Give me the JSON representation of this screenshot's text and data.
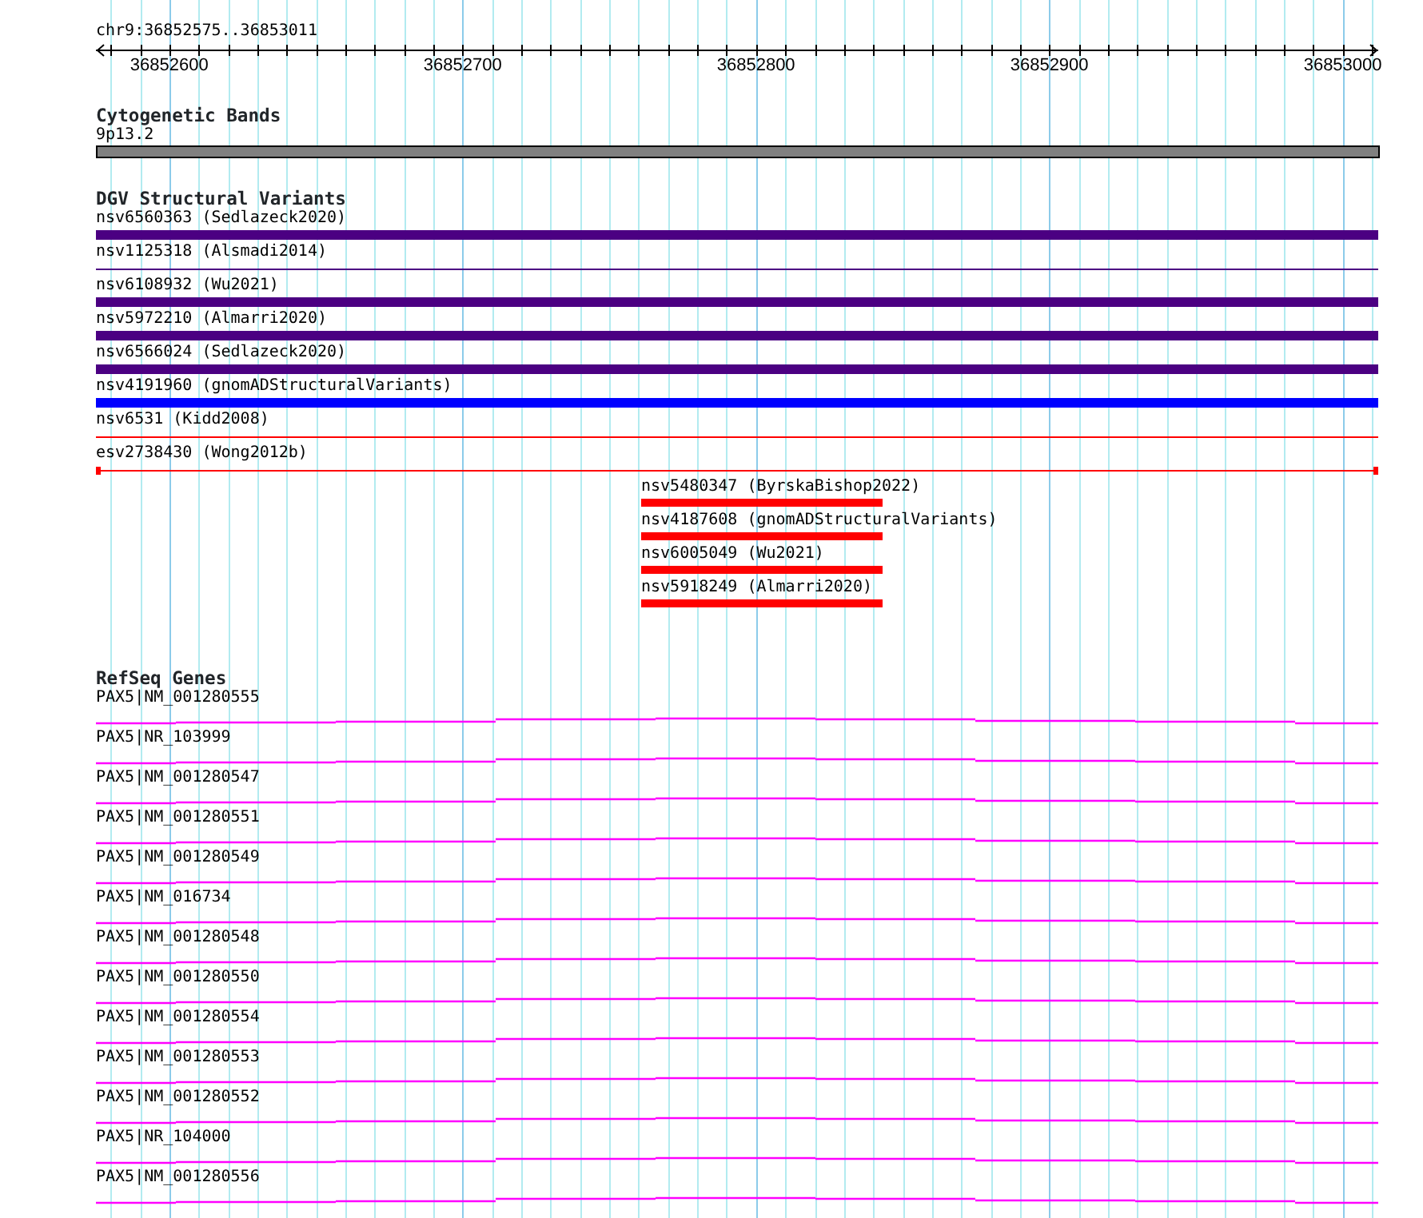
{
  "ruler": {
    "location": "chr9:36852575..36853011",
    "tick_labels": [
      "36852600",
      "36852700",
      "36852800",
      "36852900",
      "36853000"
    ]
  },
  "cytogenetic_bands": {
    "title": "Cytogenetic Bands",
    "bands": [
      {
        "label": "9p13.2",
        "color": "#808080"
      }
    ]
  },
  "dgv_structural_variants": {
    "title": "DGV Structural Variants",
    "features": [
      {
        "label": "nsv6560363 (Sedlazeck2020)",
        "kind": "thick",
        "color": "#4b0082"
      },
      {
        "label": "nsv1125318 (Alsmadi2014)",
        "kind": "line",
        "color": "#4b0082"
      },
      {
        "label": "nsv6108932 (Wu2021)",
        "kind": "thick",
        "color": "#4b0082"
      },
      {
        "label": "nsv5972210 (Almarri2020)",
        "kind": "thick",
        "color": "#4b0082"
      },
      {
        "label": "nsv6566024 (Sedlazeck2020)",
        "kind": "thick",
        "color": "#4b0082"
      },
      {
        "label": "nsv4191960 (gnomADStructuralVariants)",
        "kind": "thick",
        "color": "#0000ff"
      },
      {
        "label": "nsv6531 (Kidd2008)",
        "kind": "line",
        "color": "#ff0000"
      },
      {
        "label": "esv2738430 (Wong2012b)",
        "kind": "capped",
        "color": "#ff0000"
      },
      {
        "label": "nsv5480347 (ByrskaBishop2022)",
        "kind": "inset",
        "color": "#ff0000"
      },
      {
        "label": "nsv4187608 (gnomADStructuralVariants)",
        "kind": "inset",
        "color": "#ff0000"
      },
      {
        "label": "nsv6005049 (Wu2021)",
        "kind": "inset",
        "color": "#ff0000"
      },
      {
        "label": "nsv5918249 (Almarri2020)",
        "kind": "inset",
        "color": "#ff0000"
      }
    ]
  },
  "refseq_genes": {
    "title": "RefSeq Genes",
    "transcripts": [
      {
        "label": "PAX5|NM_001280555"
      },
      {
        "label": "PAX5|NR_103999"
      },
      {
        "label": "PAX5|NM_001280547"
      },
      {
        "label": "PAX5|NM_001280551"
      },
      {
        "label": "PAX5|NM_001280549"
      },
      {
        "label": "PAX5|NM_016734"
      },
      {
        "label": "PAX5|NM_001280548"
      },
      {
        "label": "PAX5|NM_001280550"
      },
      {
        "label": "PAX5|NM_001280554"
      },
      {
        "label": "PAX5|NM_001280553"
      },
      {
        "label": "PAX5|NM_001280552"
      },
      {
        "label": "PAX5|NR_104000"
      },
      {
        "label": "PAX5|NM_001280556"
      }
    ]
  }
}
